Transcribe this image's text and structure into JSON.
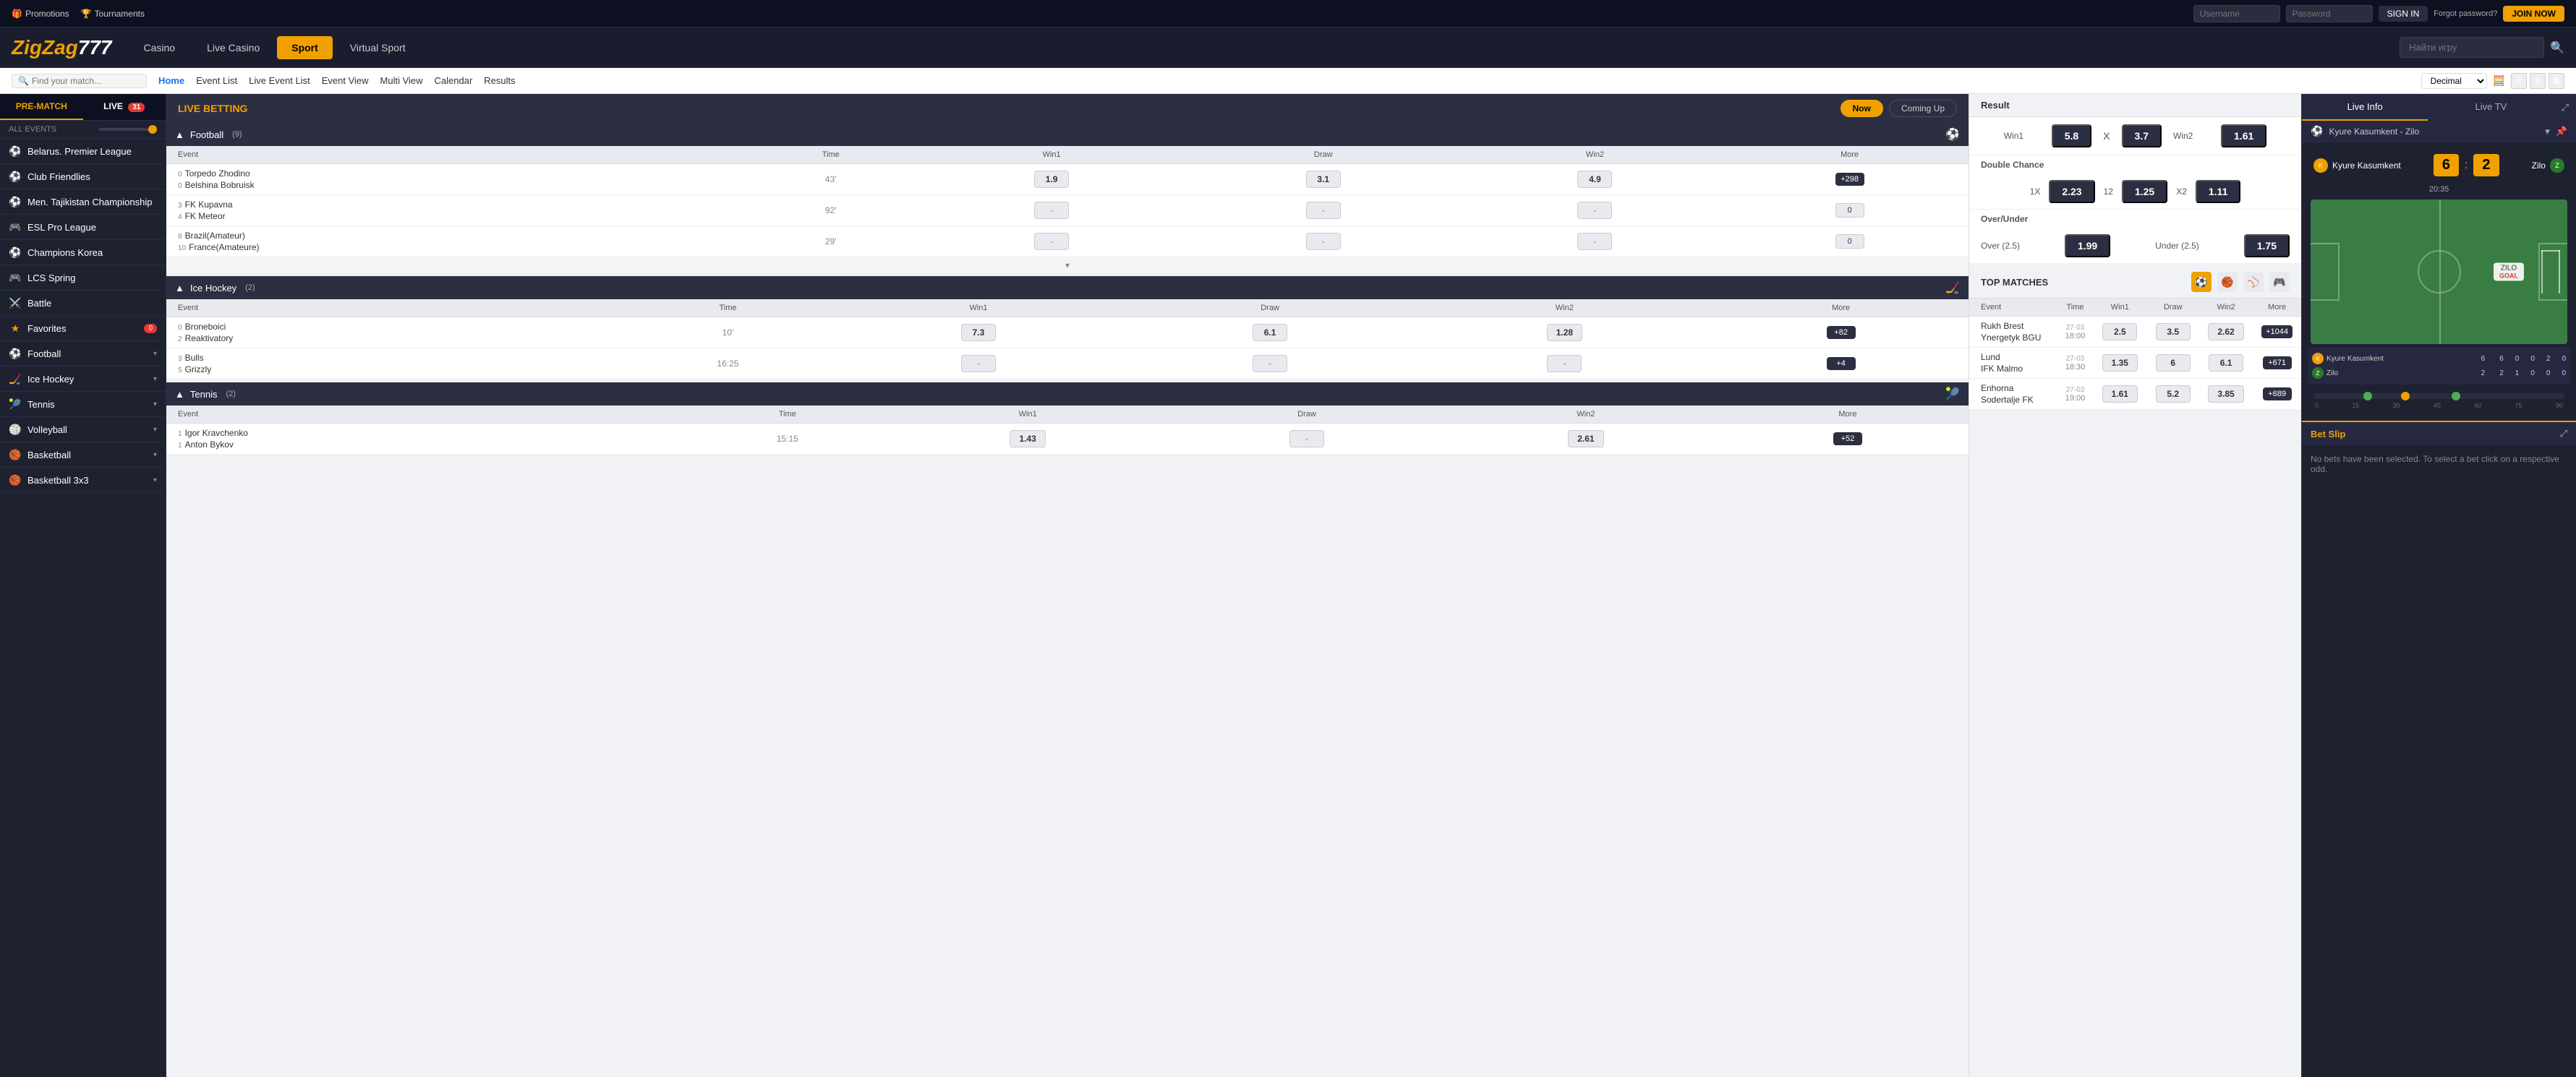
{
  "topNav": {
    "promotions": "Promotions",
    "tournaments": "Tournaments",
    "usernamePlaceholder": "Username",
    "passwordPlaceholder": "Password",
    "signinLabel": "SIGN IN",
    "joinLabel": "JOIN NOW",
    "forgotPassword": "Forgot password?"
  },
  "mainNav": {
    "logo": "ZigZag777",
    "tabs": [
      {
        "label": "Casino",
        "active": false
      },
      {
        "label": "Live Casino",
        "active": false
      },
      {
        "label": "Sport",
        "active": true
      },
      {
        "label": "Virtual Sport",
        "active": false
      }
    ],
    "searchPlaceholder": "Найти игру"
  },
  "secondaryNav": {
    "links": [
      {
        "label": "Home",
        "active": true
      },
      {
        "label": "Event List",
        "active": false
      },
      {
        "label": "Live Event List",
        "active": false
      },
      {
        "label": "Event View",
        "active": false
      },
      {
        "label": "Multi View",
        "active": false
      },
      {
        "label": "Calendar",
        "active": false
      },
      {
        "label": "Results",
        "active": false
      }
    ],
    "searchPlaceholder": "Find your match...",
    "decimal": "Decimal"
  },
  "sidebar": {
    "prematch": "PRE-MATCH",
    "live": "LIVE",
    "liveCount": "31",
    "allEvents": "ALL EVENTS",
    "sports": [
      {
        "name": "Belarus. Premier League",
        "icon": "⚽",
        "hasArrow": false
      },
      {
        "name": "Club Friendlies",
        "icon": "⚽",
        "hasArrow": false
      },
      {
        "name": "Men. Tajikistan Championship",
        "icon": "⚽",
        "hasArrow": false
      },
      {
        "name": "ESL Pro League",
        "icon": "🎮",
        "hasArrow": false
      },
      {
        "name": "Champions Korea",
        "icon": "⚽",
        "hasArrow": false
      },
      {
        "name": "LCS Spring",
        "icon": "🎮",
        "hasArrow": false
      },
      {
        "name": "Battle",
        "icon": "⚔️",
        "hasArrow": false
      },
      {
        "name": "Favorites",
        "icon": "⭐",
        "hasArrow": false,
        "isFavorite": true,
        "count": "0"
      },
      {
        "name": "Football",
        "icon": "⚽",
        "hasArrow": true
      },
      {
        "name": "Ice Hockey",
        "icon": "🏒",
        "hasArrow": true
      },
      {
        "name": "Tennis",
        "icon": "🎾",
        "hasArrow": true
      },
      {
        "name": "Volleyball",
        "icon": "🏐",
        "hasArrow": true
      },
      {
        "name": "Basketball",
        "icon": "🏀",
        "hasArrow": true
      },
      {
        "name": "Basketball 3x3",
        "icon": "🏀",
        "hasArrow": true
      }
    ]
  },
  "liveBetting": {
    "title": "LIVE BETTING",
    "tabs": [
      {
        "label": "Now",
        "active": true
      },
      {
        "label": "Coming Up",
        "active": false
      }
    ]
  },
  "footballSection": {
    "sport": "Football",
    "count": "(9)",
    "columns": {
      "event": "Event",
      "time": "Time",
      "win1": "Win1",
      "draw": "Draw",
      "win2": "Win2",
      "more": "More"
    },
    "events": [
      {
        "team1num": "0",
        "team1": "Torpedo Zhodino",
        "team2num": "0",
        "team2": "Belshina Bobruisk",
        "time": "43'",
        "win1": "1.9",
        "draw": "3.1",
        "win2": "4.9",
        "more": "+298"
      },
      {
        "team1num": "3",
        "team1": "FK Kupavna",
        "team2num": "4",
        "team2": "FK Meteor",
        "time": "92'",
        "win1": "-",
        "draw": "-",
        "win2": "-",
        "more": "0"
      },
      {
        "team1num": "8",
        "team1": "Brazil(Amateur)",
        "team2num": "10",
        "team2": "France(Amateure)",
        "time": "29'",
        "win1": "-",
        "draw": "-",
        "win2": "-",
        "more": "0"
      }
    ]
  },
  "iceHockeySection": {
    "sport": "Ice Hockey",
    "count": "(2)",
    "columns": {
      "event": "Event",
      "time": "Time",
      "win1": "Win1",
      "draw": "Draw",
      "win2": "Win2",
      "more": "More"
    },
    "events": [
      {
        "team1num": "0",
        "team1": "Broneboici",
        "team2num": "2",
        "team2": "Reaktivatory",
        "time": "10'",
        "win1": "7.3",
        "draw": "6.1",
        "win2": "1.28",
        "more": "+82"
      },
      {
        "team1num": "3",
        "team1": "Bulls",
        "team2num": "5",
        "team2": "Grizzly",
        "time": "16:25",
        "win1": "-",
        "draw": "-",
        "win2": "-",
        "more": "+4"
      }
    ]
  },
  "tennisSection": {
    "sport": "Tennis",
    "count": "(2)",
    "columns": {
      "event": "Event",
      "time": "Time",
      "win1": "Win1",
      "draw": "Draw",
      "win2": "Win2",
      "more": "More"
    },
    "events": [
      {
        "team1num": "1",
        "team1": "Igor Kravchenko",
        "team2num": "1",
        "team2": "Anton Bykov",
        "time": "15:15",
        "win1": "1.43",
        "draw": "-",
        "win2": "2.61",
        "more": "+52"
      }
    ]
  },
  "resultPanel": {
    "title": "Result",
    "win1Label": "Win1",
    "win1Odds": "5.8",
    "xLabel": "X",
    "xOdds": "3.7",
    "win2Label": "Win2",
    "win2Odds": "1.61"
  },
  "doubleChance": {
    "title": "Double Chance",
    "options": [
      {
        "label": "1X",
        "odds": "2.23"
      },
      {
        "label": "12",
        "odds": "1.25"
      },
      {
        "label": "X2",
        "odds": "1.11"
      }
    ]
  },
  "overUnder": {
    "title": "Over/Under",
    "overLabel": "Over (2.5)",
    "overOdds": "1.99",
    "underLabel": "Under (2.5)",
    "underOdds": "1.75"
  },
  "topMatches": {
    "title": "TOP MATCHES",
    "columns": {
      "event": "Event",
      "time": "Time",
      "win1": "Win1",
      "draw": "Draw",
      "win2": "Win2",
      "more": "More"
    },
    "matches": [
      {
        "team1": "Rukh Brest",
        "team2": "Ynergetyk BGU",
        "date": "27-03",
        "time": "18:00",
        "win1": "2.5",
        "draw": "3.5",
        "win2": "2.62",
        "more": "+1044"
      },
      {
        "team1": "Lund",
        "team2": "IFK Malmo",
        "date": "27-03",
        "time": "18:30",
        "win1": "1.35",
        "draw": "6",
        "win2": "6.1",
        "more": "+671"
      },
      {
        "team1": "Enhorna",
        "team2": "Sodertalje FK",
        "date": "27-03",
        "time": "19:00",
        "win1": "1.61",
        "draw": "5.2",
        "win2": "3.85",
        "more": "+689"
      }
    ]
  },
  "liveInfo": {
    "tabLabel": "Live Info",
    "liveTvLabel": "Live TV",
    "matchSelector": "Kyure Kasumkent - Zilo",
    "team1": "Kyure Kasumkent",
    "team2": "Zilo",
    "score1": "6",
    "score2": "2",
    "matchTime": "20:35",
    "goalText": "ZILO",
    "goalSubText": "GOAL",
    "stats": {
      "team1Name": "Kyure Kasumkent",
      "team2Name": "Zilo",
      "team1Score": "6",
      "team2Score": "2",
      "team1Goals": "6",
      "team2Goals": "2"
    },
    "timelineLabels": [
      "0",
      "15",
      "30",
      "45",
      "60",
      "75",
      "90"
    ]
  },
  "betSlip": {
    "title": "Bet Slip",
    "emptyMessage": "No bets have been selected. To select a bet click on a respective odd."
  }
}
